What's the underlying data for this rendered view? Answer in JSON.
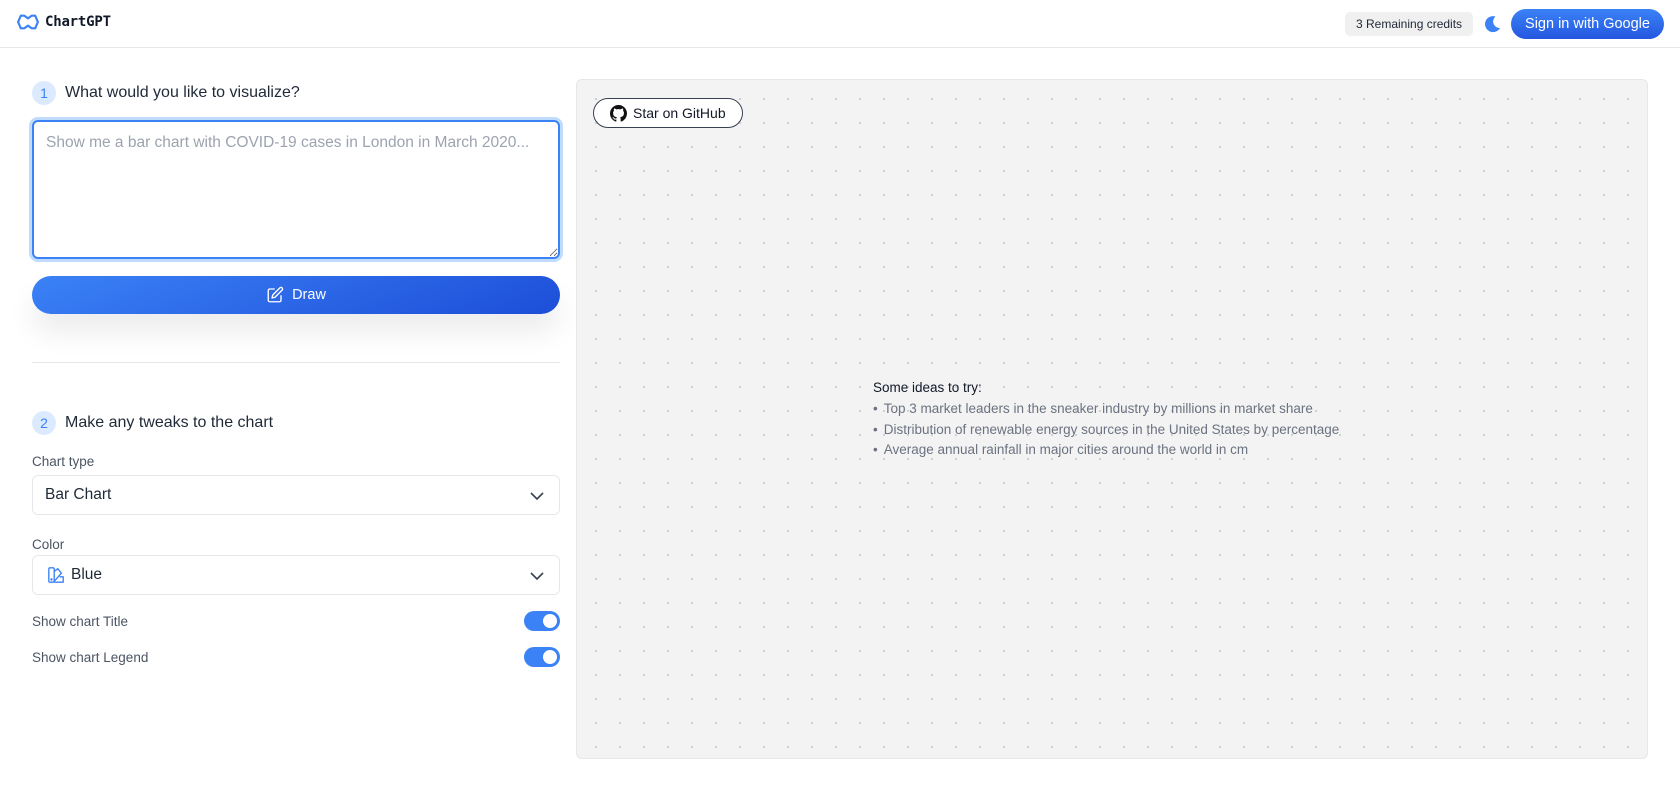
{
  "header": {
    "brand_name": "ChartGPT",
    "credits_label": "3 Remaining credits",
    "theme_icon": "moon-icon",
    "signin_label": "Sign in with Google",
    "accent_color": "#3b82f6"
  },
  "step1": {
    "number": "1",
    "title": "What would you like to visualize?",
    "prompt_value": "",
    "prompt_placeholder": "Show me a bar chart with COVID-19 cases in London in March 2020...",
    "draw_label": "Draw",
    "draw_icon": "pencil-square-icon"
  },
  "step2": {
    "number": "2",
    "title": "Make any tweaks to the chart",
    "chart_type_label": "Chart type",
    "chart_type_value": "Bar Chart",
    "color_label": "Color",
    "color_value": "Blue",
    "color_icon": "swatch-icon",
    "toggles": [
      {
        "label": "Show chart Title",
        "on": true
      },
      {
        "label": "Show chart Legend",
        "on": true
      }
    ]
  },
  "canvas": {
    "github_label": "Star on GitHub",
    "github_icon": "github-icon",
    "ideas_title": "Some ideas to try:",
    "ideas": [
      "Top 3 market leaders in the sneaker industry by millions in market share",
      "Distribution of renewable energy sources in the United States by percentage",
      "Average annual rainfall in major cities around the world in cm"
    ]
  }
}
